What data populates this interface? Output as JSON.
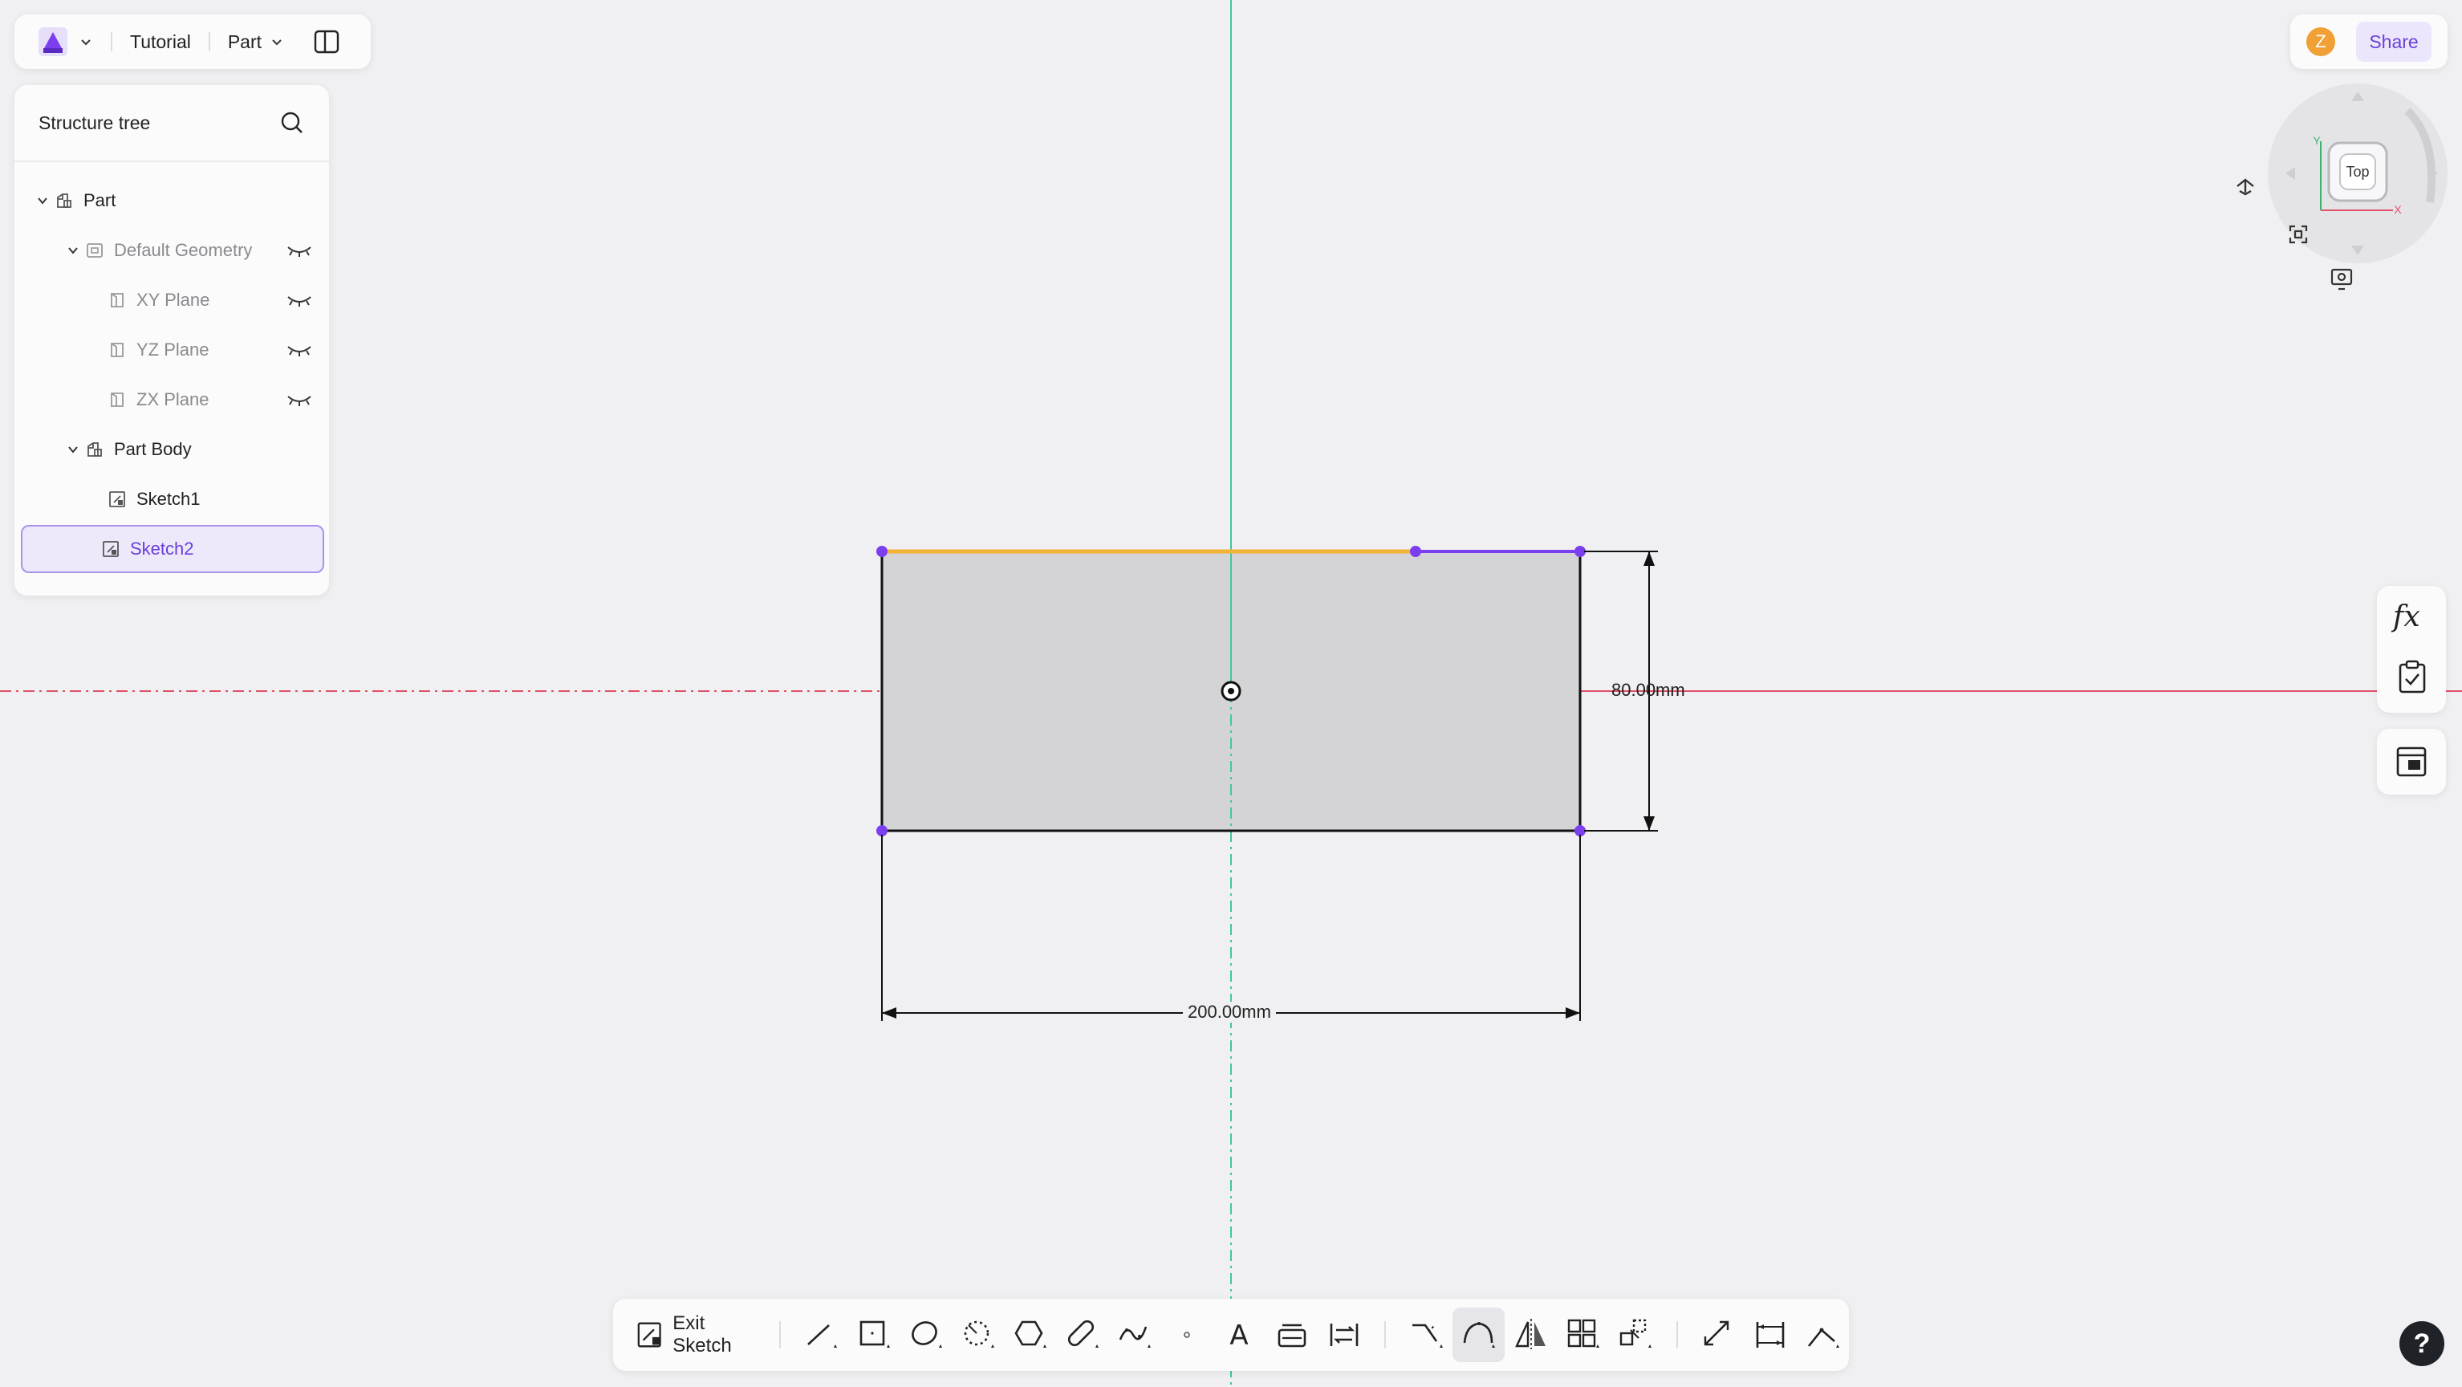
{
  "app": {
    "project_name": "Tutorial",
    "mode_label": "Part"
  },
  "tree": {
    "title": "Structure tree",
    "items": [
      {
        "label": "Part"
      },
      {
        "label": "Default Geometry"
      },
      {
        "label": "XY Plane"
      },
      {
        "label": "YZ Plane"
      },
      {
        "label": "ZX Plane"
      },
      {
        "label": "Part Body"
      },
      {
        "label": "Sketch1"
      },
      {
        "label": "Sketch2"
      }
    ]
  },
  "user": {
    "avatar_initial": "Z",
    "share_label": "Share"
  },
  "view_cube": {
    "face_label": "Top",
    "x_axis": "X",
    "y_axis": "Y"
  },
  "sketch": {
    "width_dimension": "200.00mm",
    "height_dimension": "80.00mm"
  },
  "right_panel": {
    "fx_label": "fx"
  },
  "toolbar": {
    "exit_label": "Exit Sketch",
    "text_tool_glyph": "A"
  },
  "help": {
    "label": "?"
  },
  "colors": {
    "accent": "#6a3fd8",
    "selected_edge": "#f2b338",
    "constrained_edge": "#7b3ff0",
    "x_axis_line": "#e0506a",
    "y_axis_line": "#40c8a0",
    "sketch_fill": "#d4d4d6"
  }
}
